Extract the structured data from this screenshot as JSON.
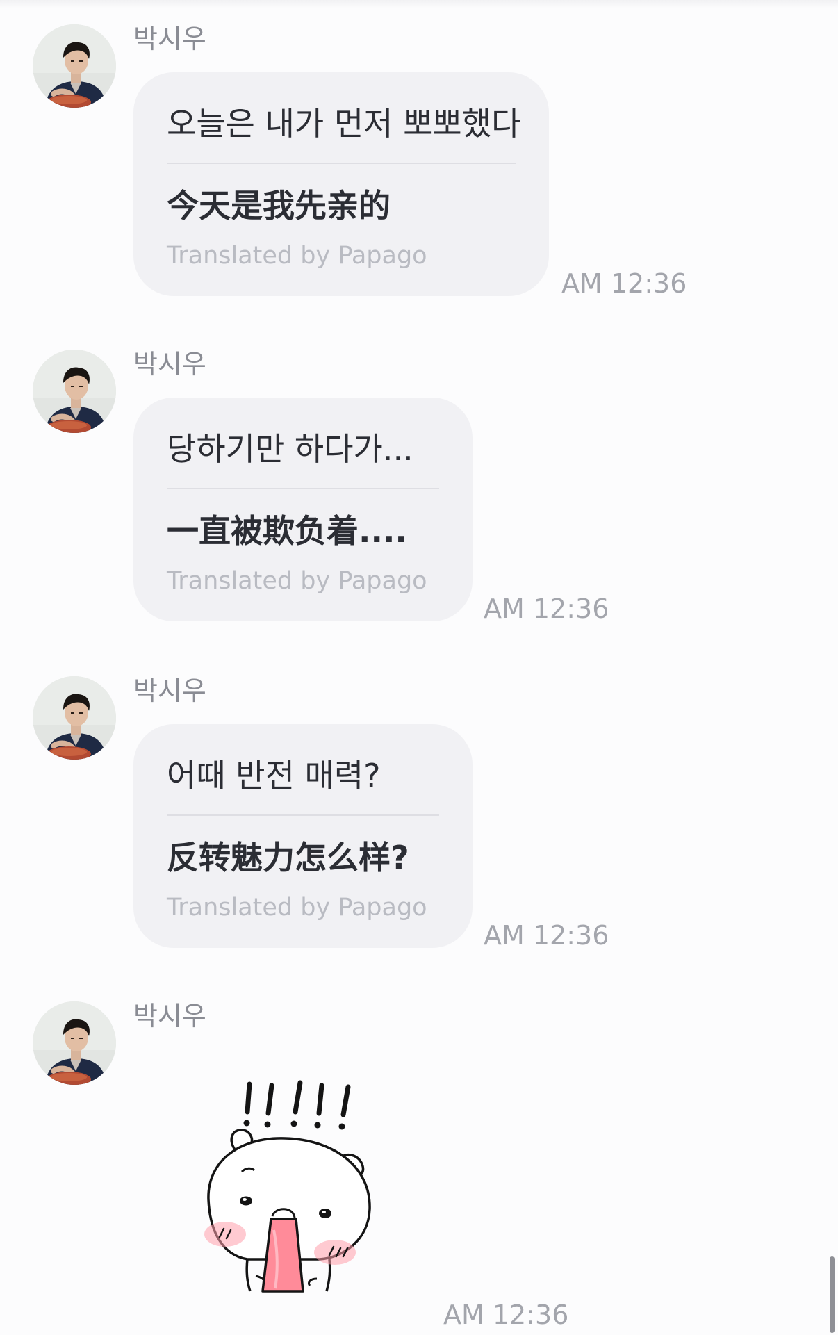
{
  "messages": [
    {
      "sender": "박시우",
      "original": "오늘은 내가 먼저 뽀뽀했다",
      "translation": "今天是我先亲的",
      "credit": "Translated by Papago",
      "time": "AM 12:36"
    },
    {
      "sender": "박시우",
      "original": "당하기만 하다가...",
      "translation": "一直被欺负着....",
      "credit": "Translated by Papago",
      "time": "AM 12:36"
    },
    {
      "sender": "박시우",
      "original": "어때 반전 매력?",
      "translation": "反转魅力怎么样?",
      "credit": "Translated by Papago",
      "time": "AM 12:36"
    },
    {
      "sender": "박시우",
      "sticker": "surprised-bear-sticker",
      "time": "AM 12:36"
    }
  ],
  "colors": {
    "bubble": "#f1f1f4",
    "sender": "#8a8c94",
    "timestamp": "#a3a5ac",
    "credit": "#b9bbc2",
    "text": "#2b2d34"
  }
}
